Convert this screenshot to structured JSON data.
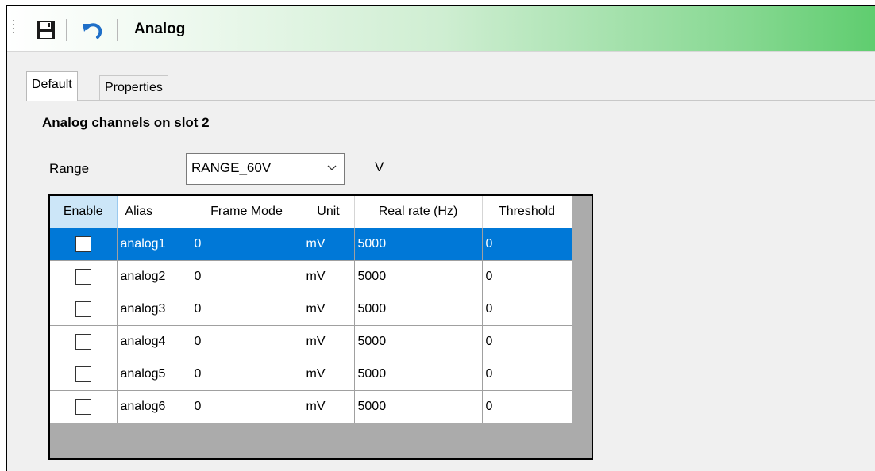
{
  "toolbar": {
    "title": "Analog",
    "save_icon": "save-icon",
    "undo_icon": "undo-icon"
  },
  "tabs": [
    {
      "label": "Default"
    },
    {
      "label": "Properties"
    }
  ],
  "section": {
    "title": "Analog channels on slot 2"
  },
  "range": {
    "label": "Range",
    "value": "RANGE_60V",
    "unit": "V"
  },
  "table": {
    "headers": [
      "Enable",
      "Alias",
      "Frame Mode",
      "Unit",
      "Real rate (Hz)",
      "Threshold"
    ],
    "rows": [
      {
        "alias": "analog1",
        "frame_mode": "0",
        "unit": "mV",
        "rate": "5000",
        "threshold": "0"
      },
      {
        "alias": "analog2",
        "frame_mode": "0",
        "unit": "mV",
        "rate": "5000",
        "threshold": "0"
      },
      {
        "alias": "analog3",
        "frame_mode": "0",
        "unit": "mV",
        "rate": "5000",
        "threshold": "0"
      },
      {
        "alias": "analog4",
        "frame_mode": "0",
        "unit": "mV",
        "rate": "5000",
        "threshold": "0"
      },
      {
        "alias": "analog5",
        "frame_mode": "0",
        "unit": "mV",
        "rate": "5000",
        "threshold": "0"
      },
      {
        "alias": "analog6",
        "frame_mode": "0",
        "unit": "mV",
        "rate": "5000",
        "threshold": "0"
      }
    ]
  },
  "colors": {
    "selection": "#0078d7",
    "toolbar_gradient_end": "#5fcd6f"
  }
}
